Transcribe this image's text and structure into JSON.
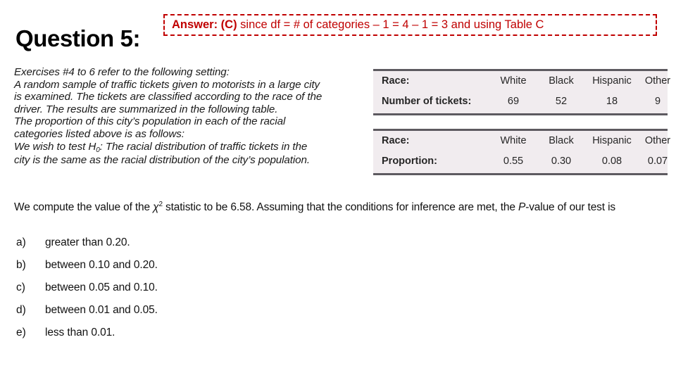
{
  "header": {
    "title": "Question 5:",
    "answer": {
      "lead": "Answer: (C)",
      "rest": " since df = # of categories – 1 = 4 – 1 = 3 and using Table C",
      "border_color": "#c00000",
      "text_color": "#c00000"
    }
  },
  "setting": {
    "lines": [
      "Exercises #4 to 6 refer to the following setting:",
      "A random sample of traffic tickets given to motorists in a large city",
      "is examined. The tickets are classified according to the race of the",
      "driver. The results are summarized in the following table.",
      "The proportion of this city’s population in each of the racial",
      "categories listed above is as follows:"
    ],
    "hypothesis_prefix": "We wish to test ",
    "hypothesis_symbol": "H",
    "hypothesis_subscript": "0",
    "hypothesis_rest": ": The racial distribution of traffic tickets in the",
    "hypothesis_line2": "city is the same as the racial distribution of the city’s population."
  },
  "tables": [
    {
      "name": "tickets",
      "header_label": "Race:",
      "value_label": "Number of tickets:",
      "categories": [
        "White",
        "Black",
        "Hispanic",
        "Other"
      ],
      "values": [
        "69",
        "52",
        "18",
        "9"
      ],
      "background": "#f1ecef",
      "rule_color": "#5d5a60"
    },
    {
      "name": "proportion",
      "header_label": "Race:",
      "value_label": "Proportion:",
      "categories": [
        "White",
        "Black",
        "Hispanic",
        "Other"
      ],
      "values": [
        "0.55",
        "0.30",
        "0.08",
        "0.07"
      ],
      "background": "#f1ecef",
      "rule_color": "#5d5a60"
    }
  ],
  "question": {
    "part1": "We compute the value of the ",
    "chi": "χ",
    "chi_exp": "2",
    "part2": " statistic to be 6.58. Assuming that the conditions for inference are met, the ",
    "p_italic": "P",
    "part3": "-value of our test is"
  },
  "options": [
    {
      "key": "a)",
      "text": "greater than 0.20."
    },
    {
      "key": "b)",
      "text": "between 0.10 and 0.20."
    },
    {
      "key": "c)",
      "text": "between 0.05 and 0.10."
    },
    {
      "key": "d)",
      "text": "between 0.01 and 0.05."
    },
    {
      "key": "e)",
      "text": "less than 0.01."
    }
  ]
}
